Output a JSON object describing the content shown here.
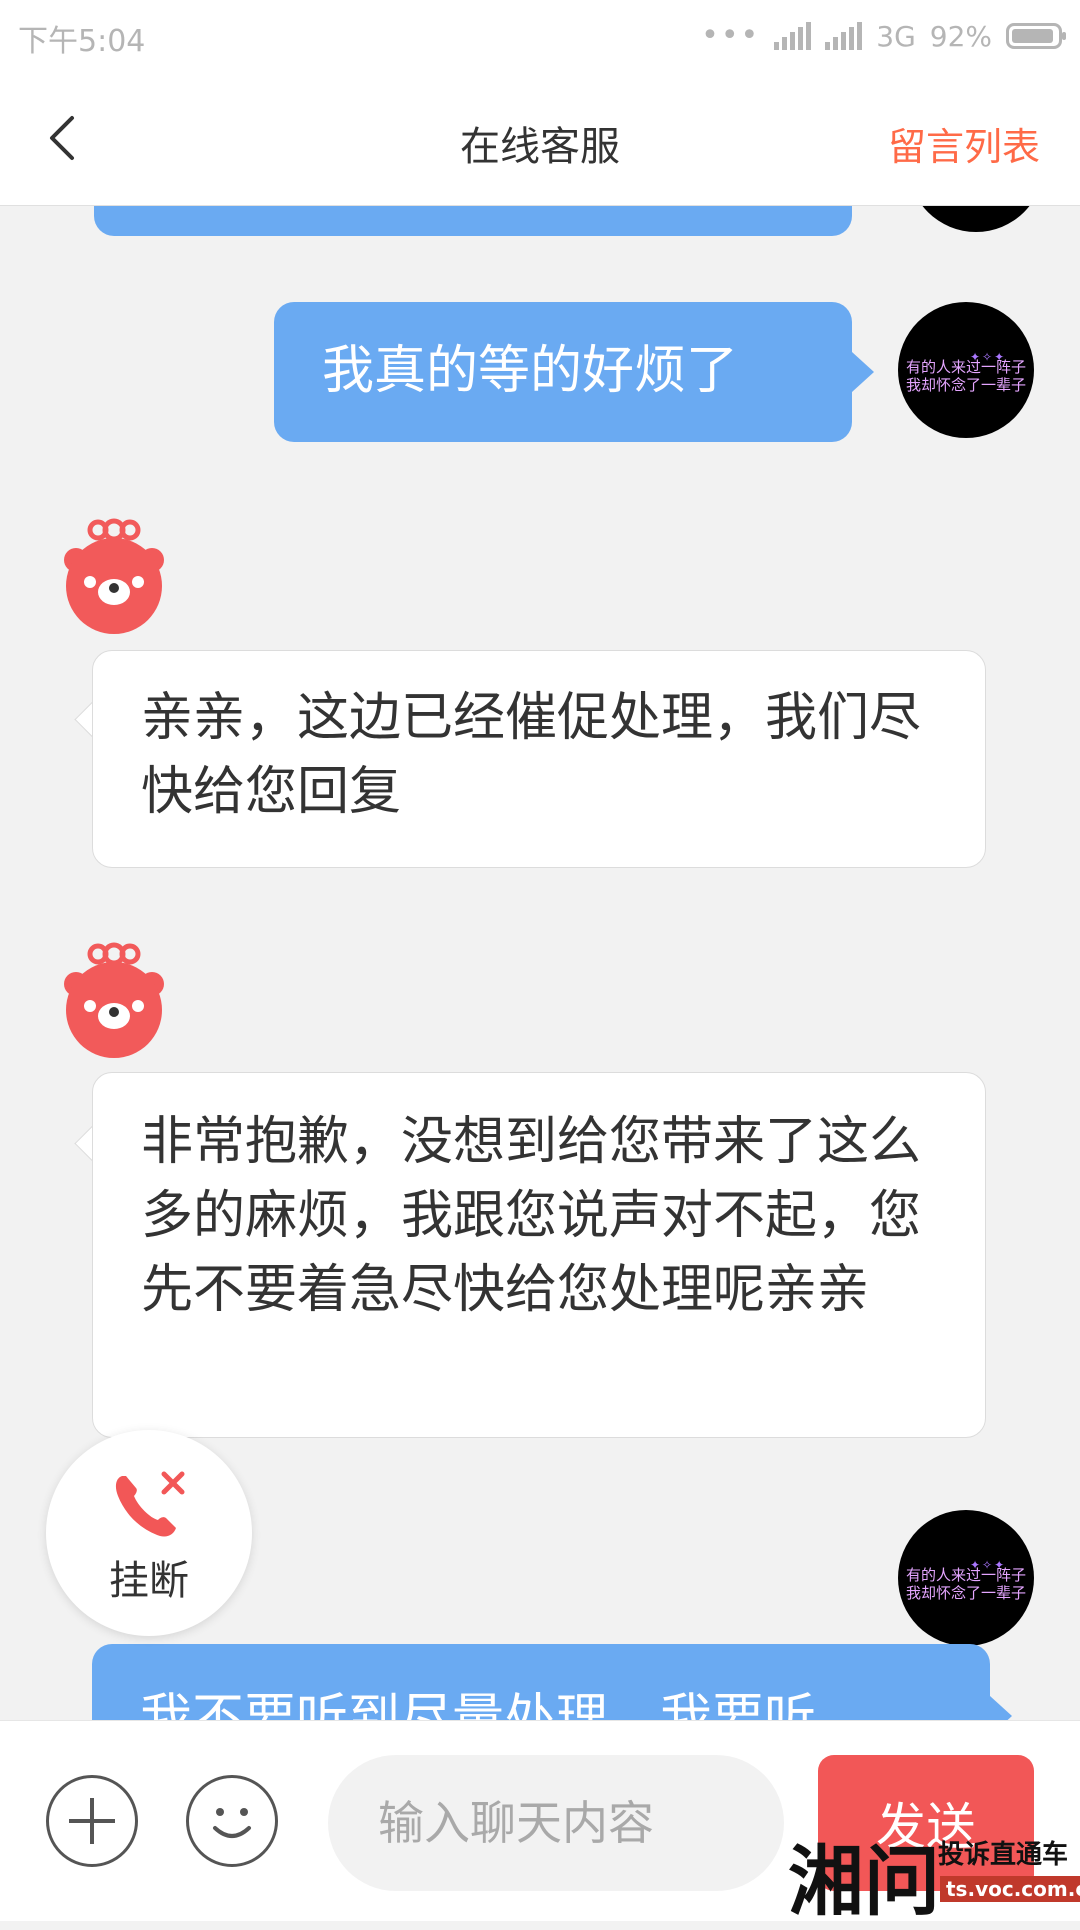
{
  "status_bar": {
    "time": "下午5:04",
    "network": "3G",
    "battery": "92%"
  },
  "header": {
    "title": "在线客服",
    "right_link": "留言列表"
  },
  "messages": [
    {
      "from": "user",
      "text": "我真的等的好烦了"
    },
    {
      "from": "agent",
      "text": "亲亲，这边已经催促处理，我们尽快给您回复"
    },
    {
      "from": "agent",
      "text": "非常抱歉，没想到给您带来了这么多的麻烦，我跟您说声对不起，您先不要着急尽快给您处理呢亲亲"
    },
    {
      "from": "user",
      "text": "我不要听到尽量处理，我要听"
    }
  ],
  "user_avatar": {
    "line1": "有的人来过一阵子",
    "line2": "我却怀念了一辈子"
  },
  "hangup": {
    "label": "挂断"
  },
  "input": {
    "placeholder": "输入聊天内容"
  },
  "send": {
    "label": "发送"
  },
  "watermark": {
    "char": "湘问",
    "subtitle": "投诉直通车",
    "url": "ts.voc.com.cn"
  },
  "colors": {
    "user_bubble": "#6aaaf2",
    "agent_bubble": "#ffffff",
    "accent_red": "#f25757",
    "header_link": "#ff6a47",
    "agent_avatar": "#f25a5a"
  }
}
